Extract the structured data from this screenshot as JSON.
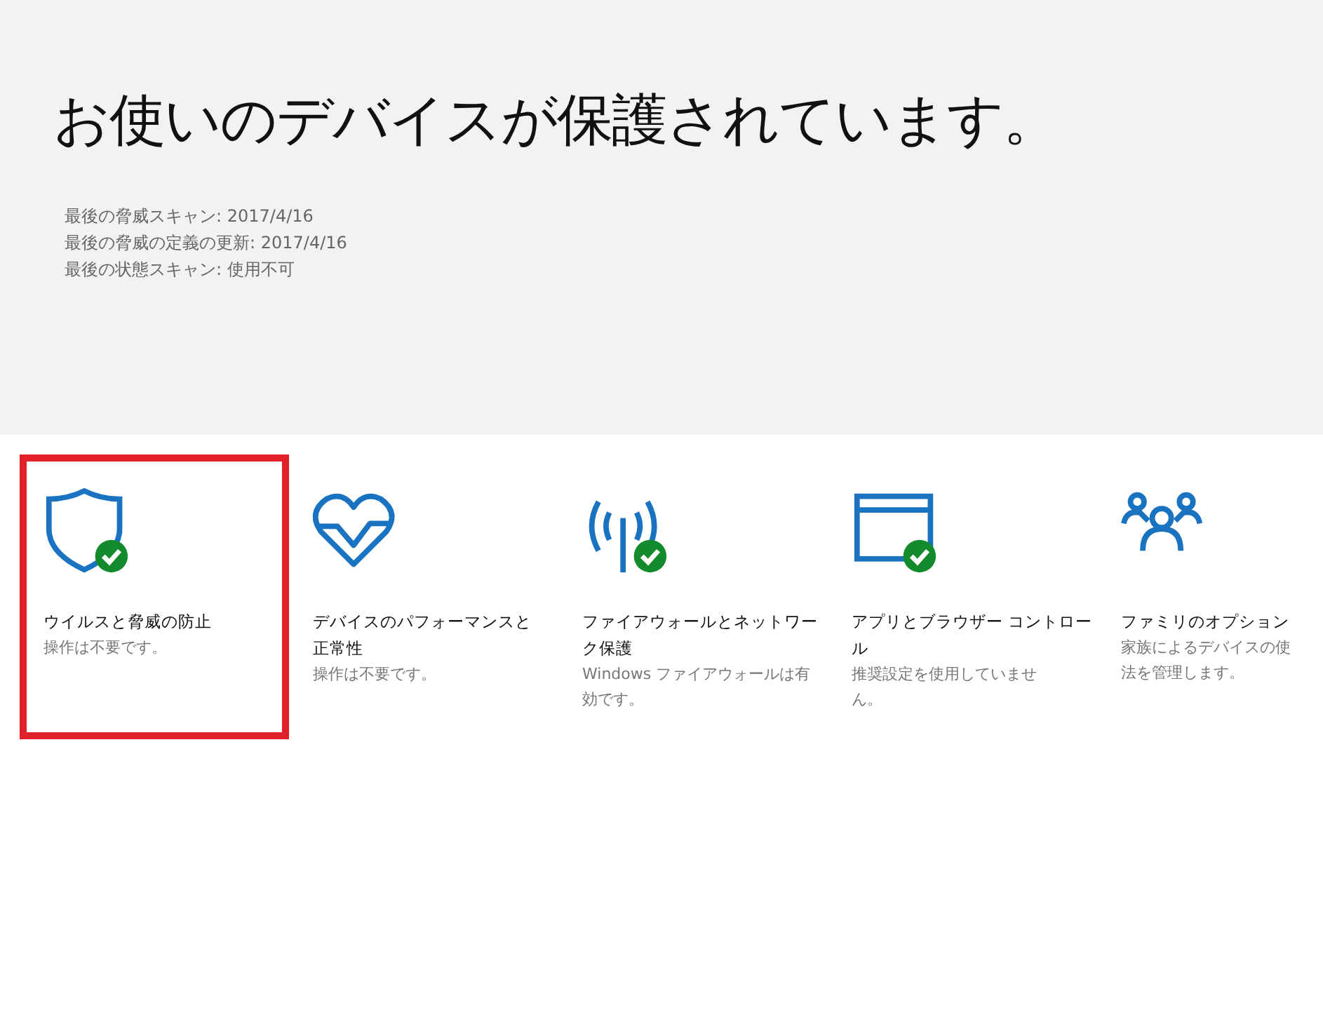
{
  "header": {
    "title": "お使いのデバイスが保護されています。",
    "details": [
      "最後の脅威スキャン: 2017/4/16",
      "最後の脅威の定義の更新: 2017/4/16",
      "最後の状態スキャン: 使用不可"
    ]
  },
  "tiles": [
    {
      "kind": "shield",
      "title": [
        "ウイルスと脅威の防止"
      ],
      "subtitle": [
        "操作は不要です。"
      ],
      "ok": true,
      "selected": true
    },
    {
      "kind": "heart",
      "title": [
        "デバイスのパフォーマンスと",
        "正常性"
      ],
      "subtitle": [
        "操作は不要です。"
      ],
      "ok": false,
      "selected": false
    },
    {
      "kind": "antenna",
      "title": [
        "ファイアウォールとネットワー",
        "ク保護"
      ],
      "subtitle": [
        "Windows ファイアウォールは有",
        "効です。"
      ],
      "ok": true,
      "selected": false
    },
    {
      "kind": "window",
      "title": [
        "アプリとブラウザー コントロー",
        "ル"
      ],
      "subtitle": [
        "推奨設定を使用していませ",
        "ん。"
      ],
      "ok": true,
      "selected": false
    },
    {
      "kind": "people",
      "title": [
        "ファミリのオプション"
      ],
      "subtitle": [
        "家族によるデバイスの使",
        "法を管理します。"
      ],
      "ok": false,
      "selected": false
    }
  ]
}
